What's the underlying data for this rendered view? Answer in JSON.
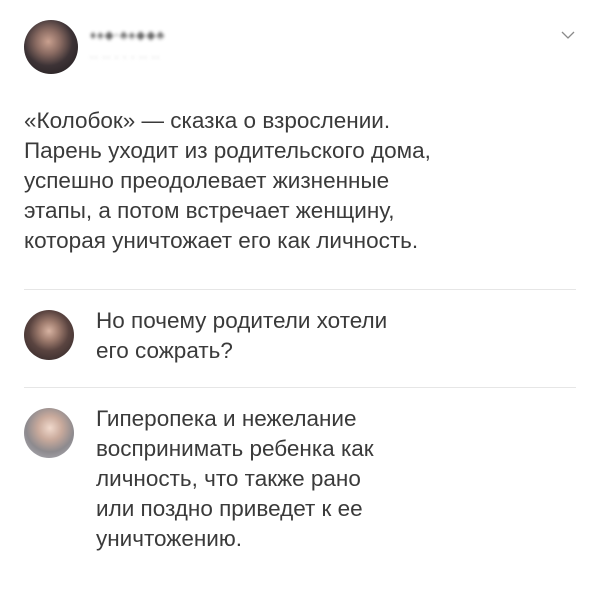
{
  "post": {
    "author_name": "♦♠◆·♣♠◆◆♣",
    "author_meta": "·· ·· · · · ·· ··",
    "menu_icon": "chevron-down-icon",
    "lines": [
      "«Колобок» — сказка о взрослении.",
      "Парень уходит из родительского дома,",
      "успешно преодолевает жизненные",
      "этапы, а потом встречает женщину,",
      "которая уничтожает его как личность."
    ]
  },
  "replies": [
    {
      "lines": [
        "Но почему родители хотели",
        "его сожрать?"
      ]
    },
    {
      "lines": [
        "Гиперопека и нежелание",
        "воспринимать ребенка как",
        "личность, что также рано",
        "или поздно приведет к ее",
        "уничтожению."
      ]
    }
  ]
}
